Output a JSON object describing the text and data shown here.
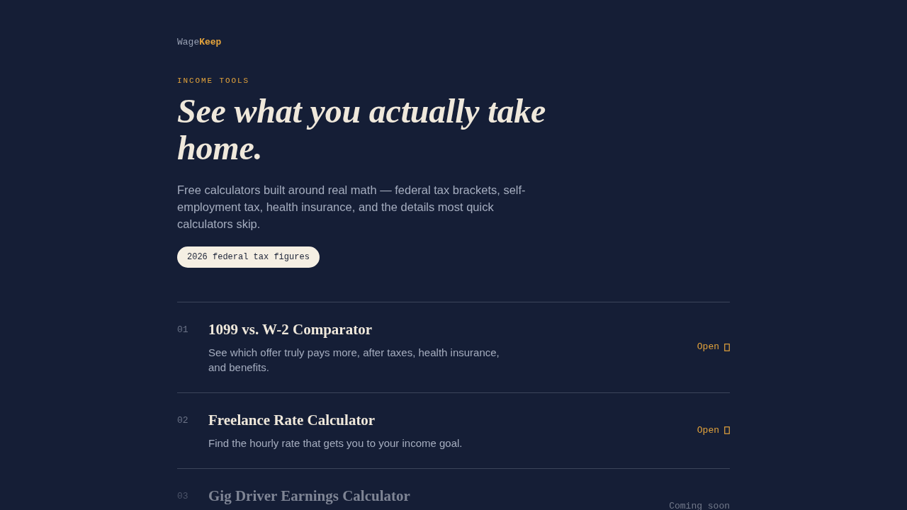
{
  "brand": {
    "name": "Wage**Keep**"
  },
  "hero": {
    "eyebrow": "INCOME TOOLS",
    "headline": "See what you actually take home.",
    "intro": "Free calculators built around real math — federal tax brackets, self-employment tax, health insurance, and the details most quick calculators skip.",
    "badge": "2026 federal tax figures"
  },
  "tools": [
    {
      "number": "01",
      "title": "1099 vs. W-2 Comparator",
      "description": "See which offer truly pays more, after taxes, health insurance, and benefits.",
      "action": "Open",
      "kind": "available"
    },
    {
      "number": "02",
      "title": "Freelance Rate Calculator",
      "description": "Find the hourly rate that gets you to your income goal.",
      "action": "Open",
      "kind": "available"
    },
    {
      "number": "03",
      "title": "Gig Driver Earnings Calculator",
      "action": "Coming soon",
      "kind": "coming_soon"
    }
  ]
}
